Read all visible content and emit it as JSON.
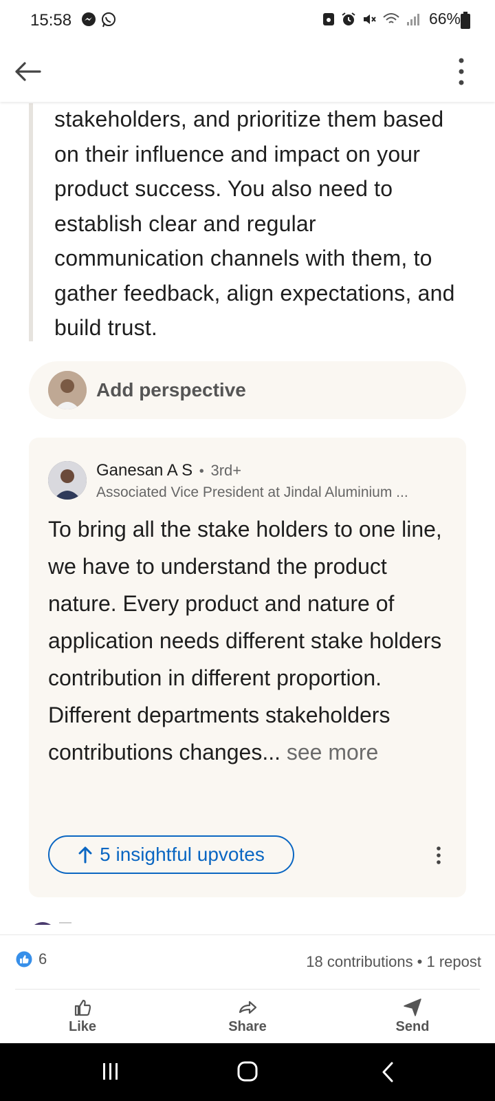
{
  "status_bar": {
    "time": "15:58",
    "battery": "66%"
  },
  "app_bar": {
    "back_icon": "arrow-left-icon",
    "menu_icon": "more-vertical-icon"
  },
  "quote": {
    "text": "stakeholders, and prioritize them based on their influence and impact on your product success. You also need to establish clear and regular communication channels with them, to gather feedback, align expectations, and build trust."
  },
  "add_perspective": {
    "label": "Add perspective"
  },
  "contribution": {
    "author_name": "Ganesan A S",
    "separator": "•",
    "degree": "3rd+",
    "headline": "Associated Vice President at Jindal Aluminium ...",
    "body": "To bring all the stake holders  to one line, we have to understand  the product nature. Every  product and nature of application needs different stake holders contribution in different  proportion. Different departments  stakeholders contributions  changes...",
    "see_more": " see more",
    "upvote_label": "5 insightful upvotes"
  },
  "engagement": {
    "reaction_count": "6",
    "stats": "18 contributions • 1 repost",
    "actions": [
      {
        "label": "Like",
        "icon": "thumbs-up-icon"
      },
      {
        "label": "Share",
        "icon": "share-arrow-icon"
      },
      {
        "label": "Send",
        "icon": "send-icon"
      }
    ]
  },
  "colors": {
    "accent": "#0a66c2",
    "card_bg": "#faf7f2",
    "quote_border": "#e6e3de"
  }
}
